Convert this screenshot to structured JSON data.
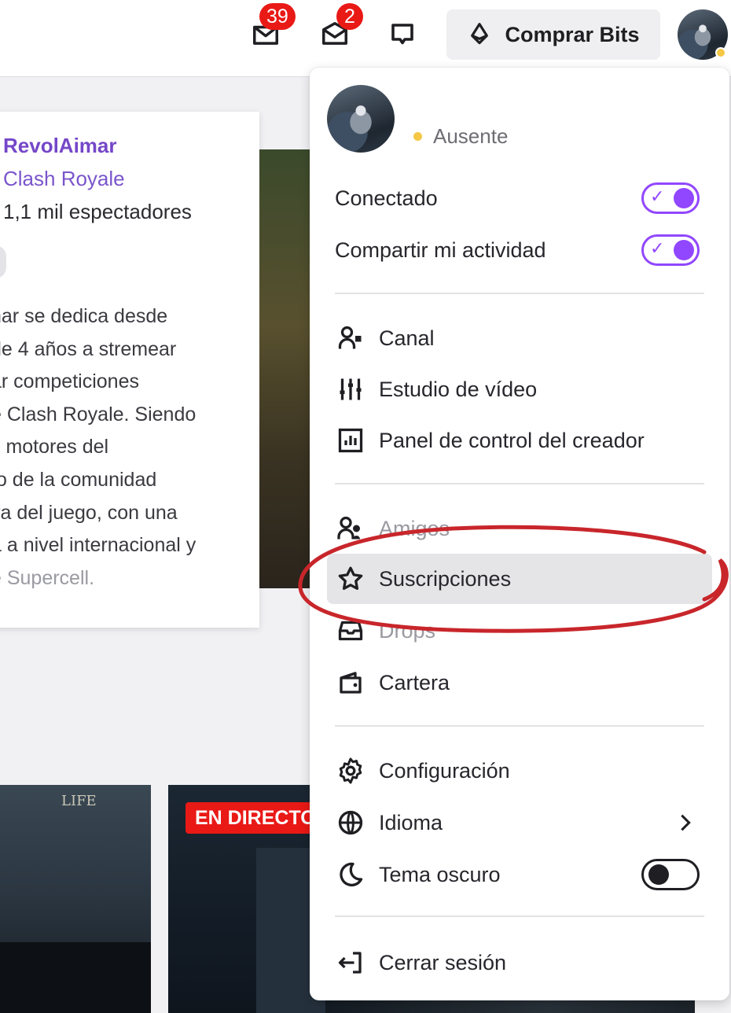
{
  "topbar": {
    "notifications_count": "39",
    "inbox_count": "2",
    "buy_bits_label": "Comprar Bits"
  },
  "card": {
    "channel_name": "RevolAimar",
    "game": "Clash Royale",
    "viewers": "1,1 mil espectadores",
    "description_lines": [
      "nar se dedica desde",
      "de 4 años a stremear",
      "ar competiciones",
      "e Clash Royale. Siendo",
      "s motores del",
      "to de la comunidad",
      "va del juego, con una",
      "a a nivel internacional y",
      "e Supercell."
    ]
  },
  "thumbnails": {
    "thumb_a_logo": "LIFE",
    "live_label": "EN DIRECTO"
  },
  "menu": {
    "status_label": "Ausente",
    "toggles": {
      "connected_label": "Conectado",
      "connected_on": true,
      "share_activity_label": "Compartir mi actividad",
      "share_activity_on": true
    },
    "items": {
      "channel": "Canal",
      "video_studio": "Estudio de vídeo",
      "creator_dashboard": "Panel de control del creador",
      "friends": "Amigos",
      "subscriptions": "Suscripciones",
      "drops": "Drops",
      "wallet": "Cartera",
      "settings": "Configuración",
      "language": "Idioma",
      "dark_theme": "Tema oscuro",
      "dark_theme_on": false,
      "logout": "Cerrar sesión"
    }
  },
  "colors": {
    "accent": "#9147ff",
    "link_purple": "#7547c9",
    "badge_red": "#e91916",
    "away_yellow": "#f5c746",
    "annotation_red": "#c8262b"
  },
  "icons": [
    "notifications-icon",
    "inbox-icon",
    "whispers-icon",
    "bits-icon",
    "channel-icon",
    "video-studio-icon",
    "dashboard-icon",
    "friends-icon",
    "star-icon",
    "drops-icon",
    "wallet-icon",
    "gear-icon",
    "globe-icon",
    "chevron-right-icon",
    "moon-icon",
    "logout-icon"
  ]
}
